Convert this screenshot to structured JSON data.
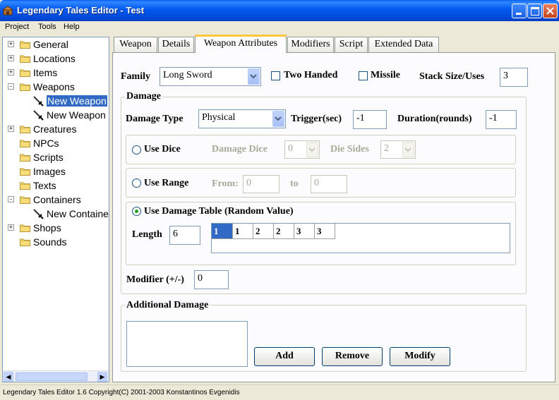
{
  "window": {
    "title": "Legendary Tales Editor - Test"
  },
  "menu": [
    "Project",
    "Tools",
    "Help"
  ],
  "tree": {
    "items": [
      {
        "label": "General",
        "expander": "+"
      },
      {
        "label": "Locations",
        "expander": "+"
      },
      {
        "label": "Items",
        "expander": "+"
      },
      {
        "label": "Weapons",
        "expander": "-"
      },
      {
        "label": "New Weapon",
        "child": true,
        "selected": true
      },
      {
        "label": "New Weapon",
        "child": true
      },
      {
        "label": "Creatures",
        "expander": "+"
      },
      {
        "label": "NPCs"
      },
      {
        "label": "Scripts"
      },
      {
        "label": "Images"
      },
      {
        "label": "Texts"
      },
      {
        "label": "Containers",
        "expander": "-"
      },
      {
        "label": "New Container",
        "child": true
      },
      {
        "label": "Shops",
        "expander": "+"
      },
      {
        "label": "Sounds"
      }
    ]
  },
  "tabs": [
    "Weapon",
    "Details",
    "Weapon Attributes",
    "Modifiers",
    "Script",
    "Extended Data"
  ],
  "active_tab": "Weapon Attributes",
  "family": {
    "label": "Family",
    "value": "Long Sword"
  },
  "two_handed": {
    "label": "Two Handed",
    "checked": false
  },
  "missile": {
    "label": "Missile",
    "checked": false
  },
  "stack_size": {
    "label": "Stack Size/Uses",
    "value": "3"
  },
  "damage": {
    "group_title": "Damage",
    "type_label": "Damage Type",
    "type_value": "Physical",
    "trigger_label": "Trigger(sec)",
    "trigger_value": "-1",
    "duration_label": "Duration(rounds)",
    "duration_value": "-1",
    "use_dice": {
      "label": "Use Dice",
      "checked": false,
      "dice_label": "Damage Dice",
      "dice_value": "0",
      "sides_label": "Die Sides",
      "sides_value": "2"
    },
    "use_range": {
      "label": "Use Range",
      "checked": false,
      "from_label": "From:",
      "from_value": "0",
      "to_label": "to",
      "to_value": "0"
    },
    "use_table": {
      "label": "Use Damage Table (Random Value)",
      "checked": true,
      "length_label": "Length",
      "length_value": "6",
      "cells": [
        "1",
        "1",
        "2",
        "2",
        "3",
        "3"
      ]
    },
    "modifier_label": "Modifier (+/-)",
    "modifier_value": "0"
  },
  "additional_damage": {
    "group_title": "Additional Damage",
    "add": "Add",
    "remove": "Remove",
    "modify": "Modify"
  },
  "status": "Legendary Tales Editor 1.6 Copyright(C) 2001-2003 Konstantinos Evgenidis"
}
